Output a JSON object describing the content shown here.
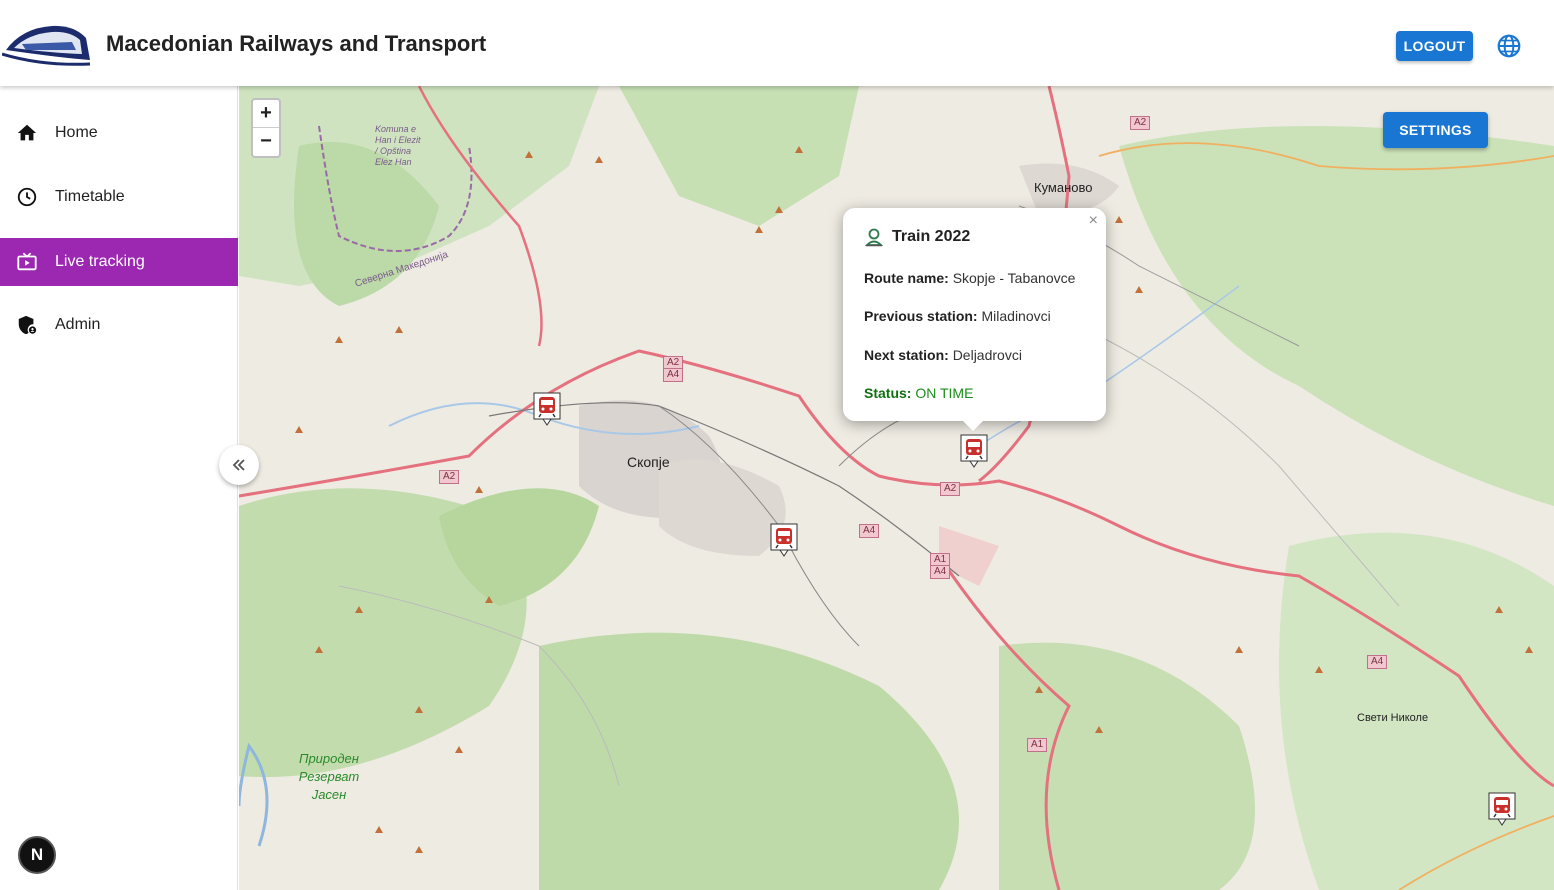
{
  "header": {
    "title": "Macedonian Railways and Transport",
    "logout_label": "LOGOUT"
  },
  "sidebar": {
    "items": [
      {
        "label": "Home",
        "icon": "home-icon"
      },
      {
        "label": "Timetable",
        "icon": "clock-icon"
      },
      {
        "label": "Live tracking",
        "icon": "tv-icon",
        "active": true
      },
      {
        "label": "Admin",
        "icon": "shield-icon"
      }
    ],
    "badge": "N"
  },
  "map": {
    "settings_label": "SETTINGS",
    "zoom_in": "+",
    "zoom_out": "−",
    "places": {
      "skopje": "Скопје",
      "kumanovo": "Куманово",
      "sveti_nikole": "Свети Николе",
      "reserve": "Природен Резерват Јасен",
      "region": "Северна Македонија",
      "komuna": "Komuna e Han i Elezit / Opština Elez Han"
    },
    "roads": [
      "A2",
      "A4",
      "A2",
      "A2",
      "A4",
      "A1",
      "A4",
      "A4",
      "A1",
      "A2"
    ]
  },
  "popup": {
    "title": "Train 2022",
    "close": "×",
    "route_label": "Route name:",
    "route_value": "Skopje - Tabanovce",
    "prev_label": "Previous station:",
    "prev_value": "Miladinovci",
    "next_label": "Next station:",
    "next_value": "Deljadrovci",
    "status_label": "Status:",
    "status_value": "ON TIME"
  },
  "colors": {
    "accent": "#1976d2",
    "active_nav": "#9c27b0",
    "status_ok": "#1a8c1a"
  }
}
